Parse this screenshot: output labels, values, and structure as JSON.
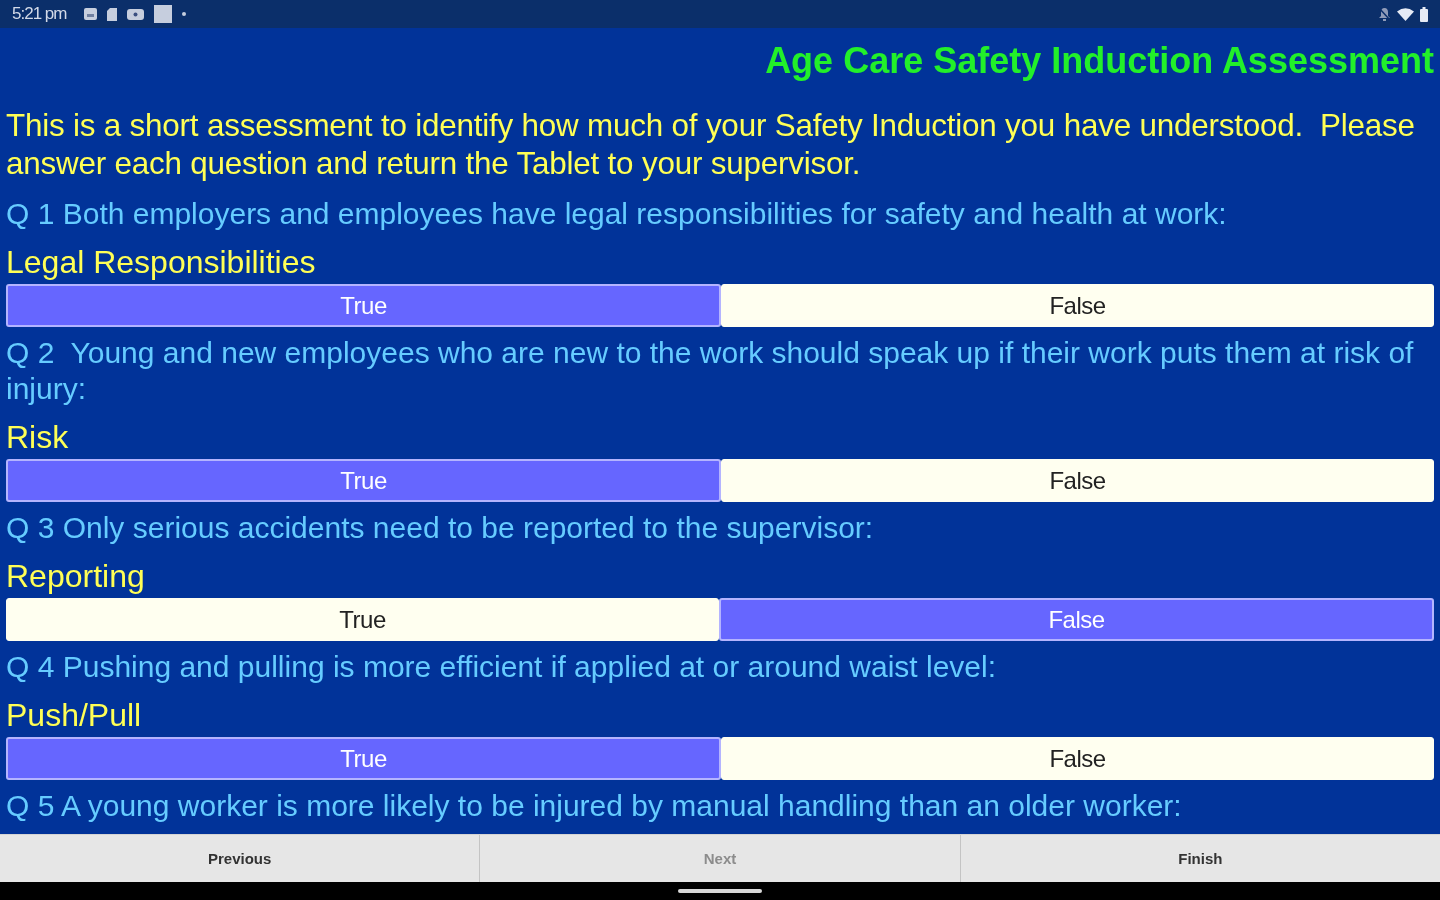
{
  "status_bar": {
    "time": "5:21 pm"
  },
  "title": "Age Care Safety Induction Assessment",
  "intro": "This is a short assessment to identify how much of your Safety Induction you have understood.  Please answer each question and return the Tablet to your supervisor.",
  "questions": [
    {
      "question": "Q 1 Both employers and employees have legal responsibilities for safety and health at work:",
      "label": "Legal Responsibilities",
      "options": [
        {
          "label": "True",
          "selected": true
        },
        {
          "label": "False",
          "selected": false
        }
      ]
    },
    {
      "question": "Q 2  Young and new employees who are new to the work should speak up if their work puts them at risk of injury:",
      "label": "Risk",
      "options": [
        {
          "label": "True",
          "selected": true
        },
        {
          "label": "False",
          "selected": false
        }
      ]
    },
    {
      "question": "Q 3 Only serious accidents need to be reported to the supervisor:",
      "label": "Reporting",
      "options": [
        {
          "label": "True",
          "selected": false
        },
        {
          "label": "False",
          "selected": true
        }
      ]
    },
    {
      "question": "Q 4 Pushing and pulling is more efficient if applied at or around waist level:",
      "label": "Push/Pull",
      "options": [
        {
          "label": "True",
          "selected": true
        },
        {
          "label": "False",
          "selected": false
        }
      ]
    },
    {
      "question": "Q 5 A young worker is more likely to be injured by manual handling than an older worker:"
    }
  ],
  "nav_buttons": [
    {
      "label": "Previous",
      "disabled": false
    },
    {
      "label": "Next",
      "disabled": true
    },
    {
      "label": "Finish",
      "disabled": false
    }
  ]
}
